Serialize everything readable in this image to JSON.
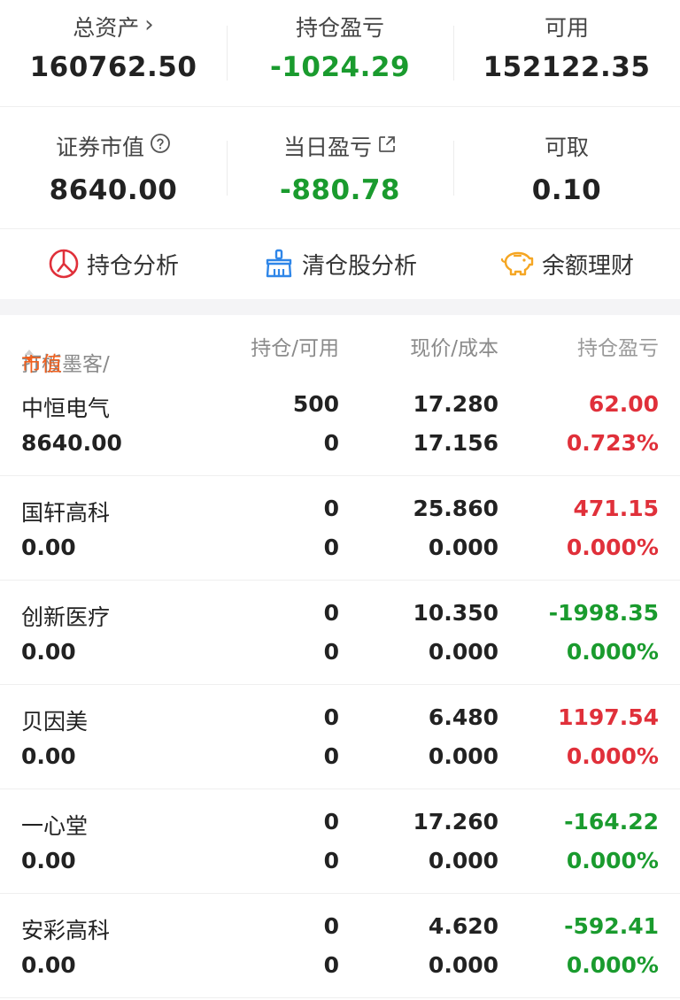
{
  "summary": {
    "total_assets": {
      "label": "总资产",
      "arrow": "›",
      "value": "160762.50"
    },
    "position_pnl": {
      "label": "持仓盈亏",
      "value": "-1024.29"
    },
    "available": {
      "label": "可用",
      "value": "152122.35"
    },
    "market_value": {
      "label": "证券市值",
      "value": "8640.00"
    },
    "daily_pnl": {
      "label": "当日盈亏",
      "value": "-880.78"
    },
    "withdrawable": {
      "label": "可取",
      "value": "0.10"
    }
  },
  "actions": [
    {
      "label": "持仓分析",
      "icon": "pie-chart-icon"
    },
    {
      "label": "清仓股分析",
      "icon": "broom-icon"
    },
    {
      "label": "余额理财",
      "icon": "piggy-bank-icon"
    }
  ],
  "table": {
    "col_name_prefix": "打板墨客/",
    "col_name_active": "市值",
    "col_position": "持仓/可用",
    "col_price": "现价/成本",
    "col_pnl": "持仓盈亏",
    "rows": [
      {
        "name": "中恒电气",
        "market_value": "8640.00",
        "position": "500",
        "available": "0",
        "price": "17.280",
        "cost": "17.156",
        "pnl": "62.00",
        "pnl_pct": "0.723%",
        "trend": "up"
      },
      {
        "name": "国轩高科",
        "market_value": "0.00",
        "position": "0",
        "available": "0",
        "price": "25.860",
        "cost": "0.000",
        "pnl": "471.15",
        "pnl_pct": "0.000%",
        "trend": "up"
      },
      {
        "name": "创新医疗",
        "market_value": "0.00",
        "position": "0",
        "available": "0",
        "price": "10.350",
        "cost": "0.000",
        "pnl": "-1998.35",
        "pnl_pct": "0.000%",
        "trend": "down"
      },
      {
        "name": "贝因美",
        "market_value": "0.00",
        "position": "0",
        "available": "0",
        "price": "6.480",
        "cost": "0.000",
        "pnl": "1197.54",
        "pnl_pct": "0.000%",
        "trend": "up"
      },
      {
        "name": "一心堂",
        "market_value": "0.00",
        "position": "0",
        "available": "0",
        "price": "17.260",
        "cost": "0.000",
        "pnl": "-164.22",
        "pnl_pct": "0.000%",
        "trend": "down"
      },
      {
        "name": "安彩高科",
        "market_value": "0.00",
        "position": "0",
        "available": "0",
        "price": "4.620",
        "cost": "0.000",
        "pnl": "-592.41",
        "pnl_pct": "0.000%",
        "trend": "down"
      }
    ]
  },
  "colors": {
    "up": "#e0303a",
    "down": "#1a9b2e",
    "accent": "#f0601e",
    "icon_blue": "#2f86e8",
    "icon_red": "#e0303a",
    "icon_orange": "#f5a623"
  }
}
